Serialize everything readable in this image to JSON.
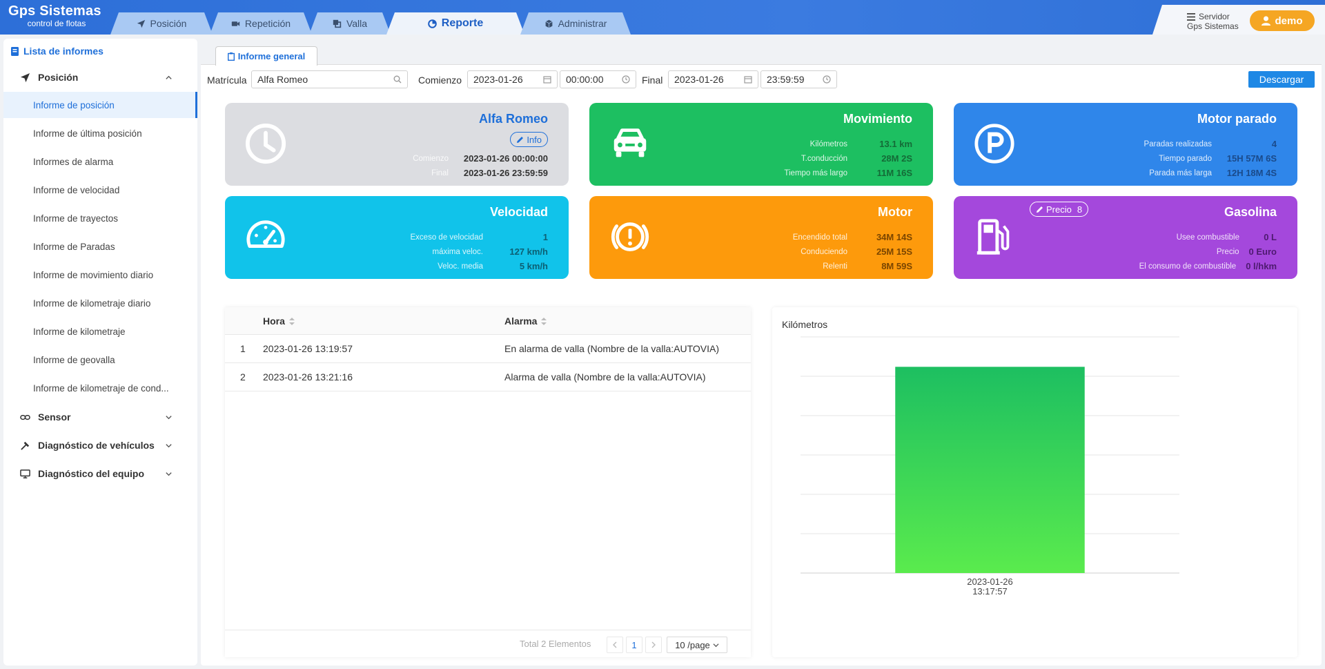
{
  "header": {
    "logo_title": "Gps Sistemas",
    "logo_sub": "control de flotas",
    "tabs": [
      {
        "label": "Posición",
        "icon": "send-icon"
      },
      {
        "label": "Repetición",
        "icon": "video-icon"
      },
      {
        "label": "Valla",
        "icon": "copy-icon"
      },
      {
        "label": "Reporte",
        "icon": "pie-chart-icon"
      },
      {
        "label": "Administrar",
        "icon": "cube-icon"
      }
    ],
    "active_tab": "Reporte",
    "server_label": "Servidor",
    "server_name": "Gps Sistemas",
    "user": "demo"
  },
  "sidebar": {
    "title": "Lista de informes",
    "group_posicion": "Posición",
    "items": [
      "Informe de posición",
      "Informe de última posición",
      "Informes de alarma",
      "Informe de velocidad",
      "Informe de trayectos",
      "Informe de Paradas",
      "Informe de movimiento diario",
      "Informe de kilometraje diario",
      "Informe de kilometraje",
      "Informe de geovalla",
      "Informe de kilometraje de cond..."
    ],
    "active_item": "Informe de posición",
    "group_sensor": "Sensor",
    "group_diag_veh": "Diagnóstico de vehículos",
    "group_diag_eq": "Diagnóstico del equipo"
  },
  "subtab": {
    "label": "Informe general"
  },
  "filter": {
    "plate_label": "Matrícula",
    "plate_value": "Alfa Romeo",
    "start_label": "Comienzo",
    "start_date": "2023-01-26",
    "start_time": "00:00:00",
    "end_label": "Final",
    "end_date": "2023-01-26",
    "end_time": "23:59:59",
    "download": "Descargar"
  },
  "cards": {
    "vehicle": {
      "title": "Alfa Romeo",
      "info": "Info",
      "k1": "Comienzo",
      "v1": "2023-01-26 00:00:00",
      "k2": "Final",
      "v2": "2023-01-26 23:59:59"
    },
    "movement": {
      "title": "Movimiento",
      "k1": "Kilómetros",
      "v1": "13.1 km",
      "k2": "T.conducción",
      "v2": "28M 2S",
      "k3": "Tiempo más largo",
      "v3": "11M 16S"
    },
    "parked": {
      "title": "Motor parado",
      "k1": "Paradas realizadas",
      "v1": "4",
      "k2": "Tiempo parado",
      "v2": "15H 57M 6S",
      "k3": "Parada más larga",
      "v3": "12H 18M 4S"
    },
    "speed": {
      "title": "Velocidad",
      "k1": "Exceso de velocidad",
      "v1": "1",
      "k2": "máxima veloc.",
      "v2": "127 km/h",
      "k3": "Veloc. media",
      "v3": "5 km/h"
    },
    "motor": {
      "title": "Motor",
      "k1": "Encendido total",
      "v1": "34M 14S",
      "k2": "Conduciendo",
      "v2": "25M 15S",
      "k3": "Relenti",
      "v3": "8M 59S"
    },
    "fuel": {
      "title": "Gasolina",
      "price_pill": "Precio",
      "price_pill_value": "8",
      "k1": "Usee combustible",
      "v1": "0 L",
      "k2": "Precio",
      "v2": "0 Euro",
      "k3": "El consumo de combustible",
      "v3": "0 l/hkm"
    }
  },
  "colors": {
    "vehicle": "#dcdde1",
    "movement": "#1dbf61",
    "parked": "#2f86ea",
    "speed": "#11c3ea",
    "motor": "#fd9a0c",
    "fuel": "#a448dc",
    "accent": "#1e6fd9"
  },
  "table": {
    "col_time": "Hora",
    "col_alarm": "Alarma",
    "rows": [
      {
        "n": "1",
        "time": "2023-01-26 13:19:57",
        "alarm": "En alarma de valla (Nombre de la valla:AUTOVIA)"
      },
      {
        "n": "2",
        "time": "2023-01-26 13:21:16",
        "alarm": "Alarma de valla (Nombre de la valla:AUTOVIA)"
      }
    ],
    "total": "Total 2 Elementos",
    "page": "1",
    "per_page": "10 /page"
  },
  "chart_data": {
    "type": "bar",
    "title": "Kilómetros",
    "categories": [
      "2023-01-26\n13:17:57"
    ],
    "values": [
      13.1
    ],
    "ylim": [
      0,
      15
    ],
    "grid": true,
    "color_top": "#1dbf61",
    "color_bottom": "#5aeb4d"
  }
}
